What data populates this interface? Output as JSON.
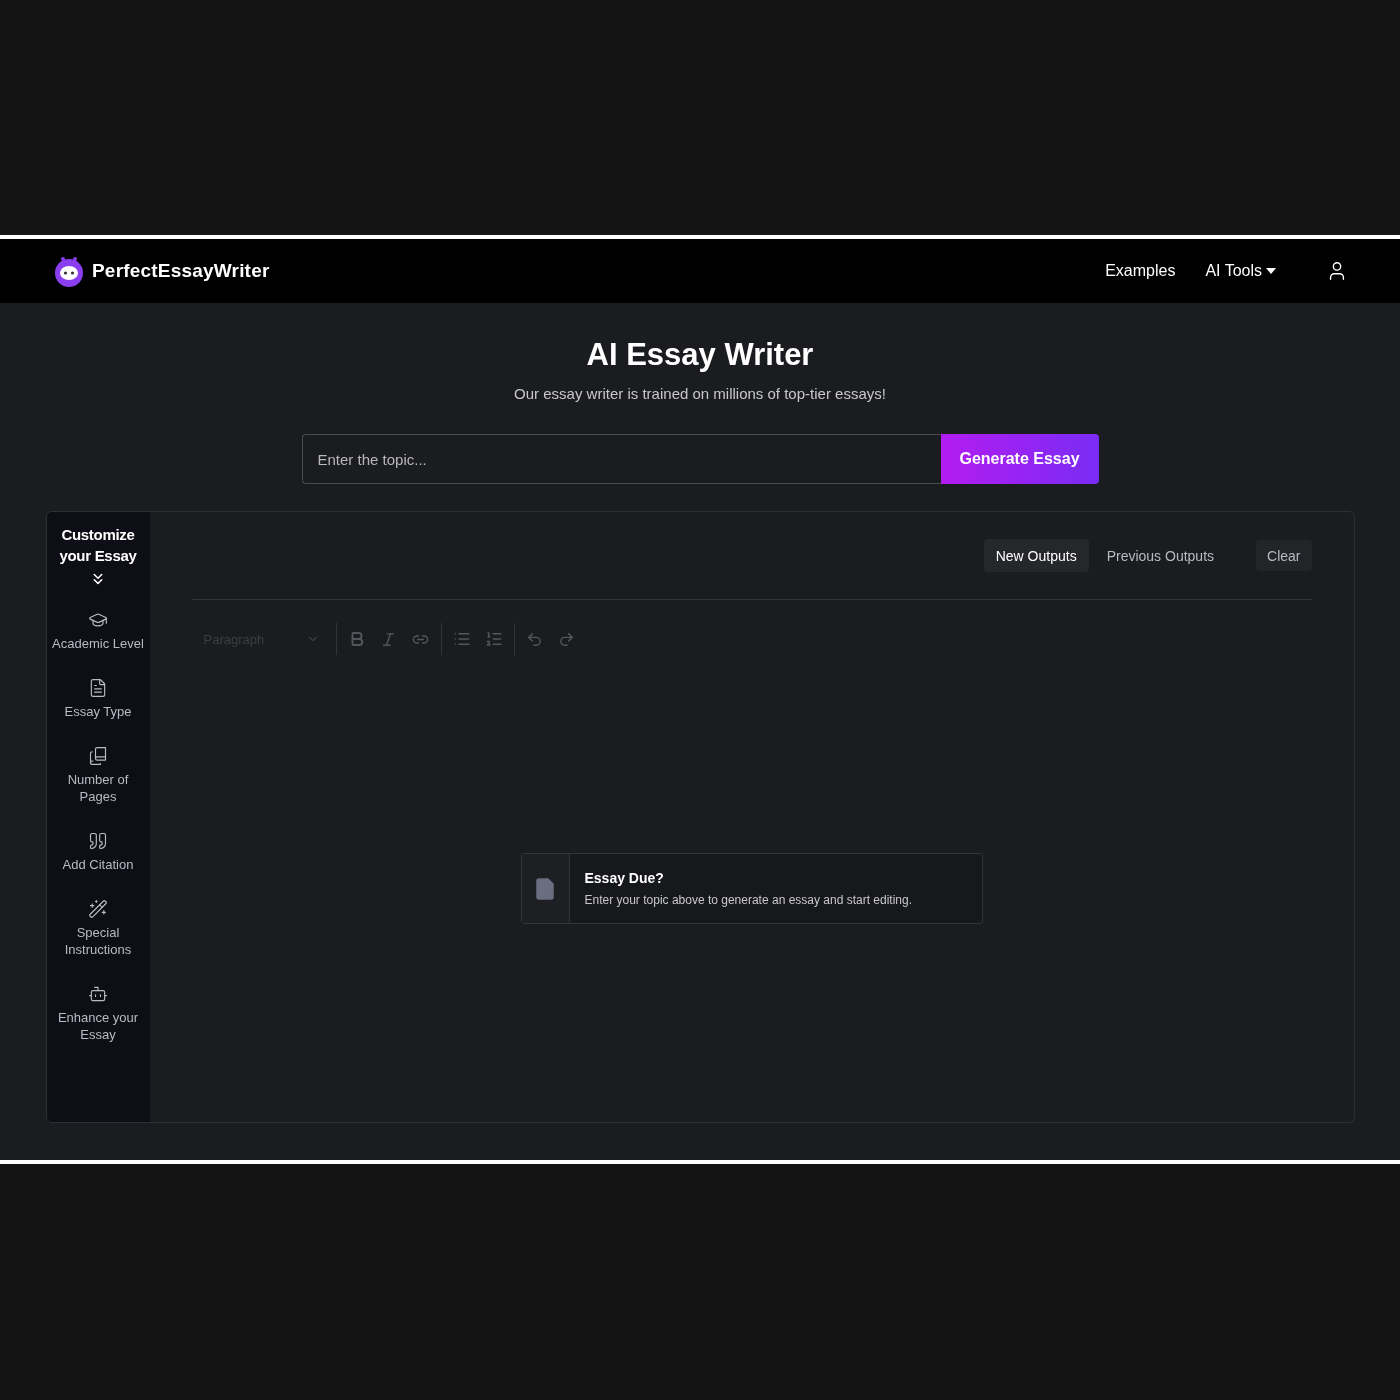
{
  "nav": {
    "brand": "PerfectEssayWriter",
    "links": [
      {
        "label": "Examples",
        "kind": "link"
      },
      {
        "label": "AI Tools",
        "kind": "dropdown"
      }
    ]
  },
  "hero": {
    "title": "AI Essay Writer",
    "subtitle": "Our essay writer is trained on millions of top-tier essays!"
  },
  "topic": {
    "placeholder": "Enter the topic...",
    "button": "Generate Essay"
  },
  "sidebar": {
    "title": "Customize your Essay",
    "items": [
      {
        "label": "Academic Level",
        "kind": "level"
      },
      {
        "label": "Essay Type",
        "kind": "type"
      },
      {
        "label": "Number of Pages",
        "kind": "pages"
      },
      {
        "label": "Add Citation",
        "kind": "citation"
      },
      {
        "label": "Special Instructions",
        "kind": "instructions"
      },
      {
        "label": "Enhance your Essay",
        "kind": "enhance"
      }
    ]
  },
  "tabs": [
    {
      "label": "New Outputs",
      "selected": true
    },
    {
      "label": "Previous Outputs",
      "selected": false
    }
  ],
  "clear_button": "Clear",
  "editor": {
    "format": "Paragraph",
    "disabled": true
  },
  "notice": {
    "title": "Essay Due?",
    "text": "Enter your topic above to generate an essay and start editing."
  }
}
